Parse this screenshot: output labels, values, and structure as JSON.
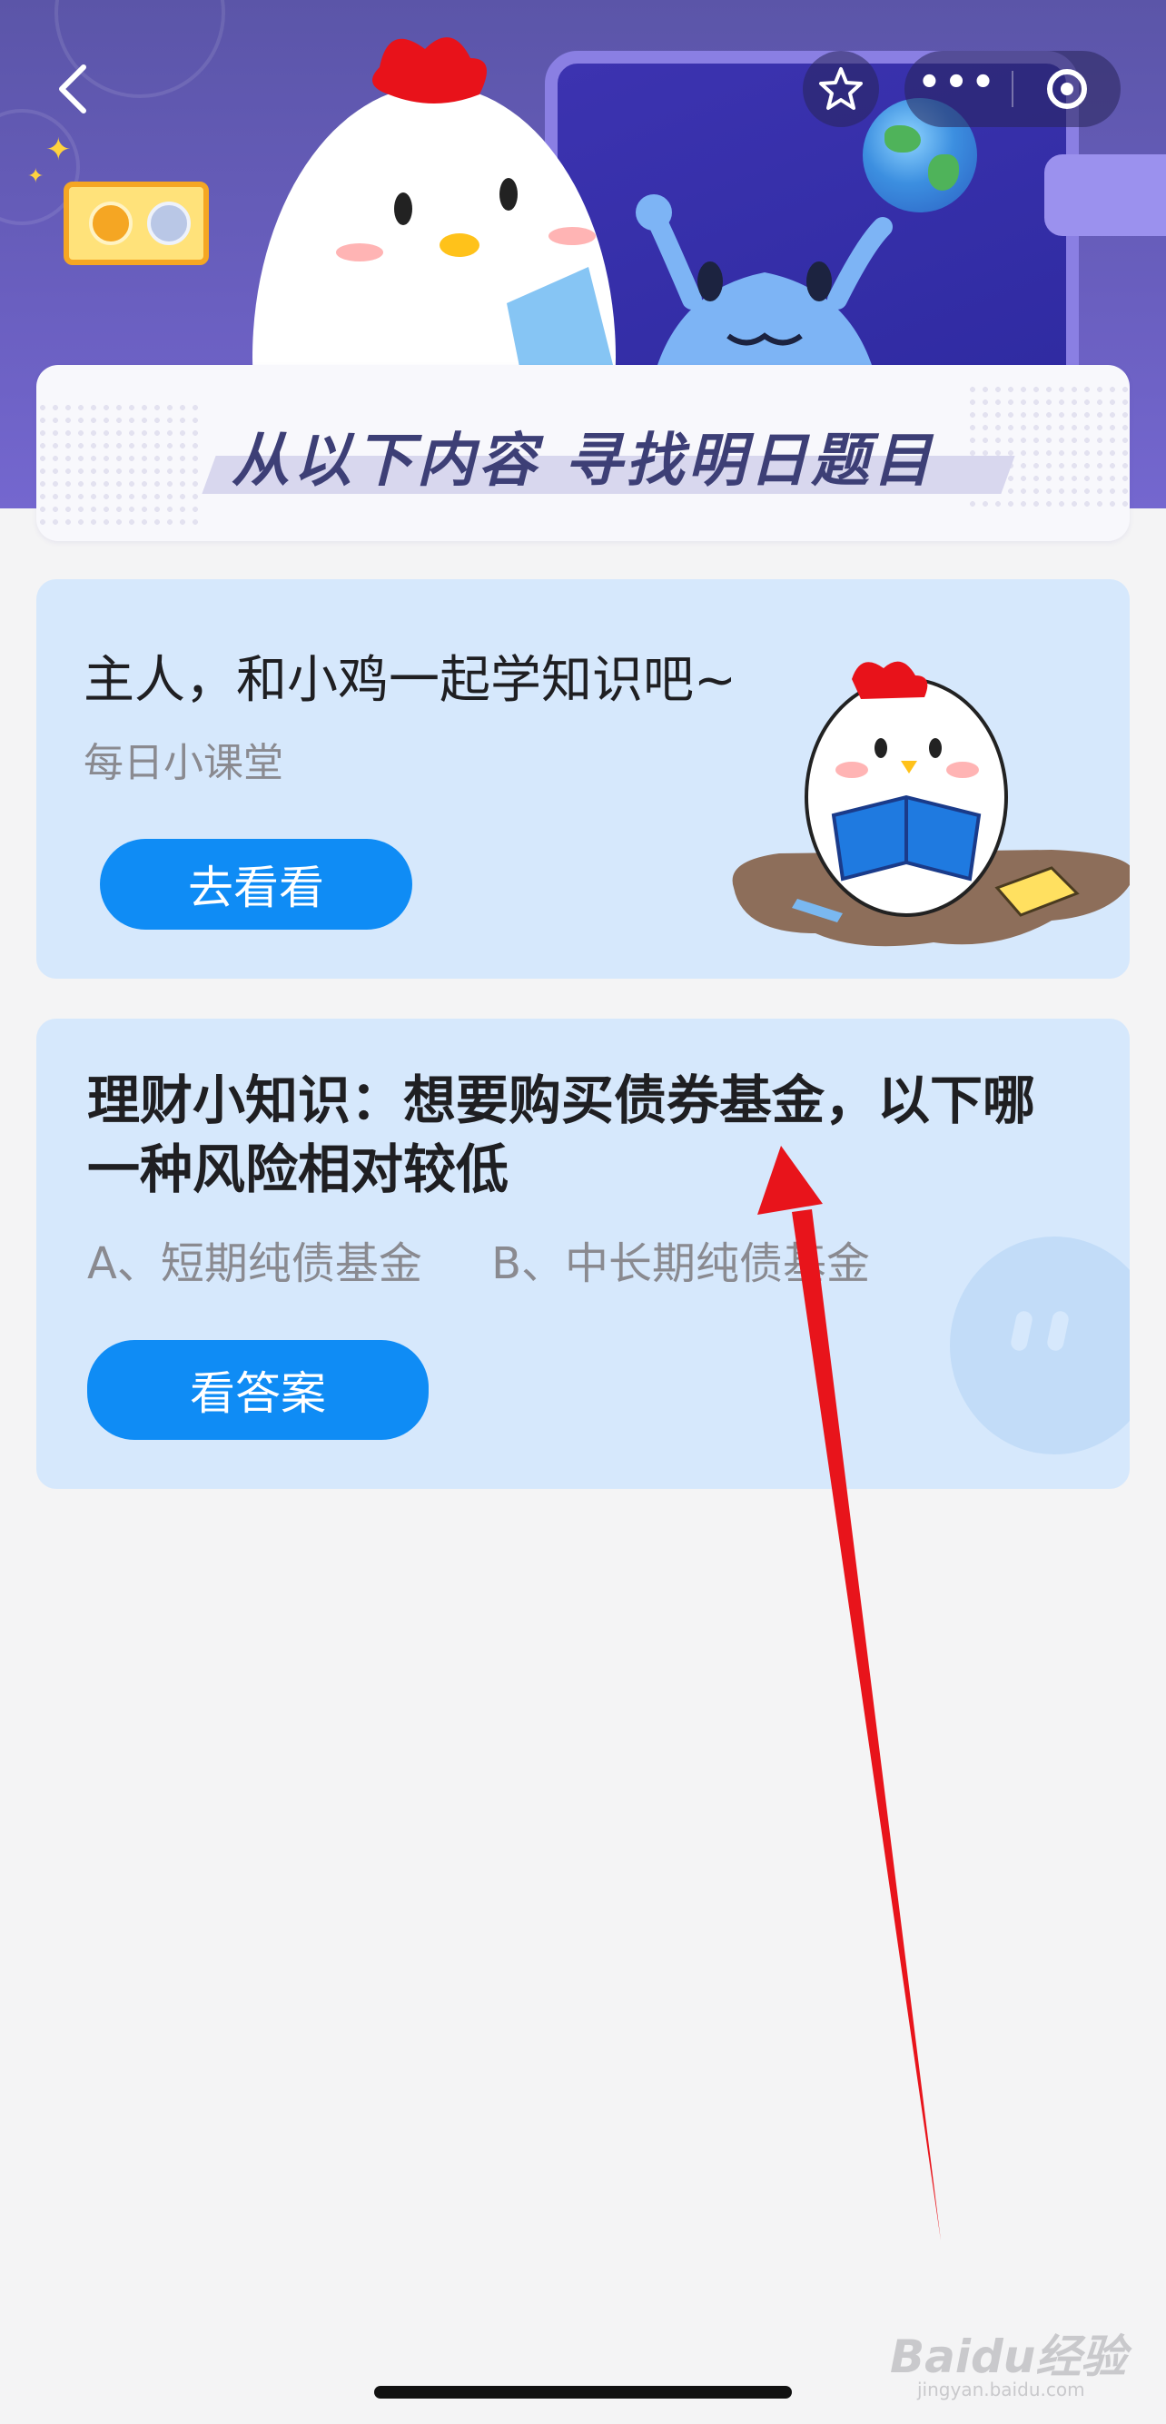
{
  "header": {
    "back_icon": "chevron-left-icon",
    "star_icon": "star-outline-icon",
    "more_icon": "more-dots-icon",
    "close_icon": "target-circle-icon"
  },
  "banner": {
    "title": "从以下内容 寻找明日题目"
  },
  "lesson_card": {
    "heading": "主人，和小鸡一起学知识吧~",
    "subtitle": "每日小课堂",
    "button_label": "去看看"
  },
  "quiz_card": {
    "question": "理财小知识：想要购买债券基金，以下哪一种风险相对较低",
    "options": "A、短期纯债基金     B、中长期纯债基金",
    "button_label": "看答案"
  },
  "watermark": {
    "text": "Baidu经验",
    "sub": "jingyan.baidu.com"
  },
  "colors": {
    "header_bg": "#5b55a8",
    "card_bg": "#d6e8fc",
    "button_blue": "#0f8cf5",
    "banner_title": "#3d3f76",
    "annotation_arrow": "#e8141b"
  }
}
